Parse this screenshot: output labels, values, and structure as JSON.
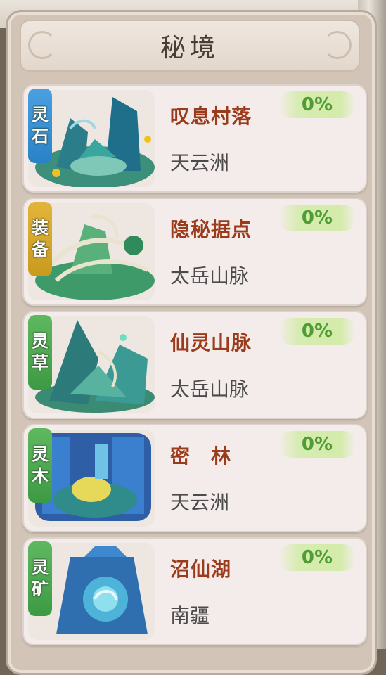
{
  "title": "秘境",
  "colors": {
    "name": "#9b3b1c",
    "region": "#4b4b4b",
    "progress": "#4f9d33",
    "badge_blue": "#2a82c6",
    "badge_gold": "#c99a1e",
    "badge_green": "#3d9a44"
  },
  "cards": [
    {
      "badge": [
        "灵",
        "石"
      ],
      "badge_color": "blue",
      "name": "叹息村落",
      "region": "天云洲",
      "progress": "0%",
      "progress_value": 0
    },
    {
      "badge": [
        "装",
        "备"
      ],
      "badge_color": "gold",
      "name": "隐秘据点",
      "region": "太岳山脉",
      "progress": "0%",
      "progress_value": 0
    },
    {
      "badge": [
        "灵",
        "草"
      ],
      "badge_color": "green",
      "name": "仙灵山脉",
      "region": "太岳山脉",
      "progress": "0%",
      "progress_value": 0
    },
    {
      "badge": [
        "灵",
        "木"
      ],
      "badge_color": "green",
      "name": "密　林",
      "region": "天云洲",
      "progress": "0%",
      "progress_value": 0
    },
    {
      "badge": [
        "灵",
        "矿"
      ],
      "badge_color": "green",
      "name": "沼仙湖",
      "region": "南疆",
      "progress": "0%",
      "progress_value": 0
    }
  ]
}
